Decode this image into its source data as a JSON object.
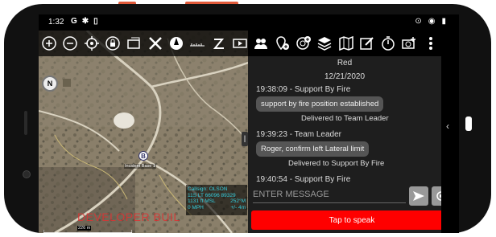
{
  "status": {
    "time": "1:32",
    "left_icons": [
      "G",
      "✱",
      "▯"
    ],
    "right_icons": [
      "⊙",
      "◉",
      "▮"
    ]
  },
  "toolbar": {
    "icons": [
      "zoom-in-icon",
      "zoom-out-icon",
      "locate-icon",
      "lock-icon",
      "layers-frame-icon",
      "close-x-icon",
      "compass-icon",
      "ruler-icon",
      "z-draw-icon",
      "video-icon",
      "team-icon",
      "map-pin-plus-icon",
      "target-plus-icon",
      "stack-layers-icon",
      "map-icon",
      "edit-note-icon",
      "timer-icon",
      "camera-add-icon",
      "more-vertical-icon"
    ]
  },
  "map": {
    "compass_label": "N",
    "marker_label": "B",
    "marker_name": "Incident Base 1",
    "scale_label": "226 m",
    "watermark": "DEVELOPER BUIL",
    "info": {
      "callsign": "Callsign: OLSON",
      "coord": "11S LT 66096 89329",
      "elev": "1131 ft MSL",
      "heading": "252°M",
      "speed": "0 MPH",
      "accuracy": "+/- 4m"
    }
  },
  "chat": {
    "title": "Red",
    "date": "12/21/2020",
    "messages": [
      {
        "header": "19:38:09 - Support By Fire",
        "text": "support by fire position established",
        "delivered": "Delivered to Team Leader"
      },
      {
        "header": "19:39:23 - Team Leader",
        "text": "Roger, confirm left Lateral limit",
        "delivered": "Delivered to Support By Fire"
      },
      {
        "header": "19:40:54 - Support By Fire"
      }
    ],
    "placeholder": "ENTER MESSAGE",
    "speak_label": "Tap to speak"
  },
  "colors": {
    "speak": "#ff0000",
    "info_text": "#33ccdd",
    "watermark": "#dd3333"
  }
}
